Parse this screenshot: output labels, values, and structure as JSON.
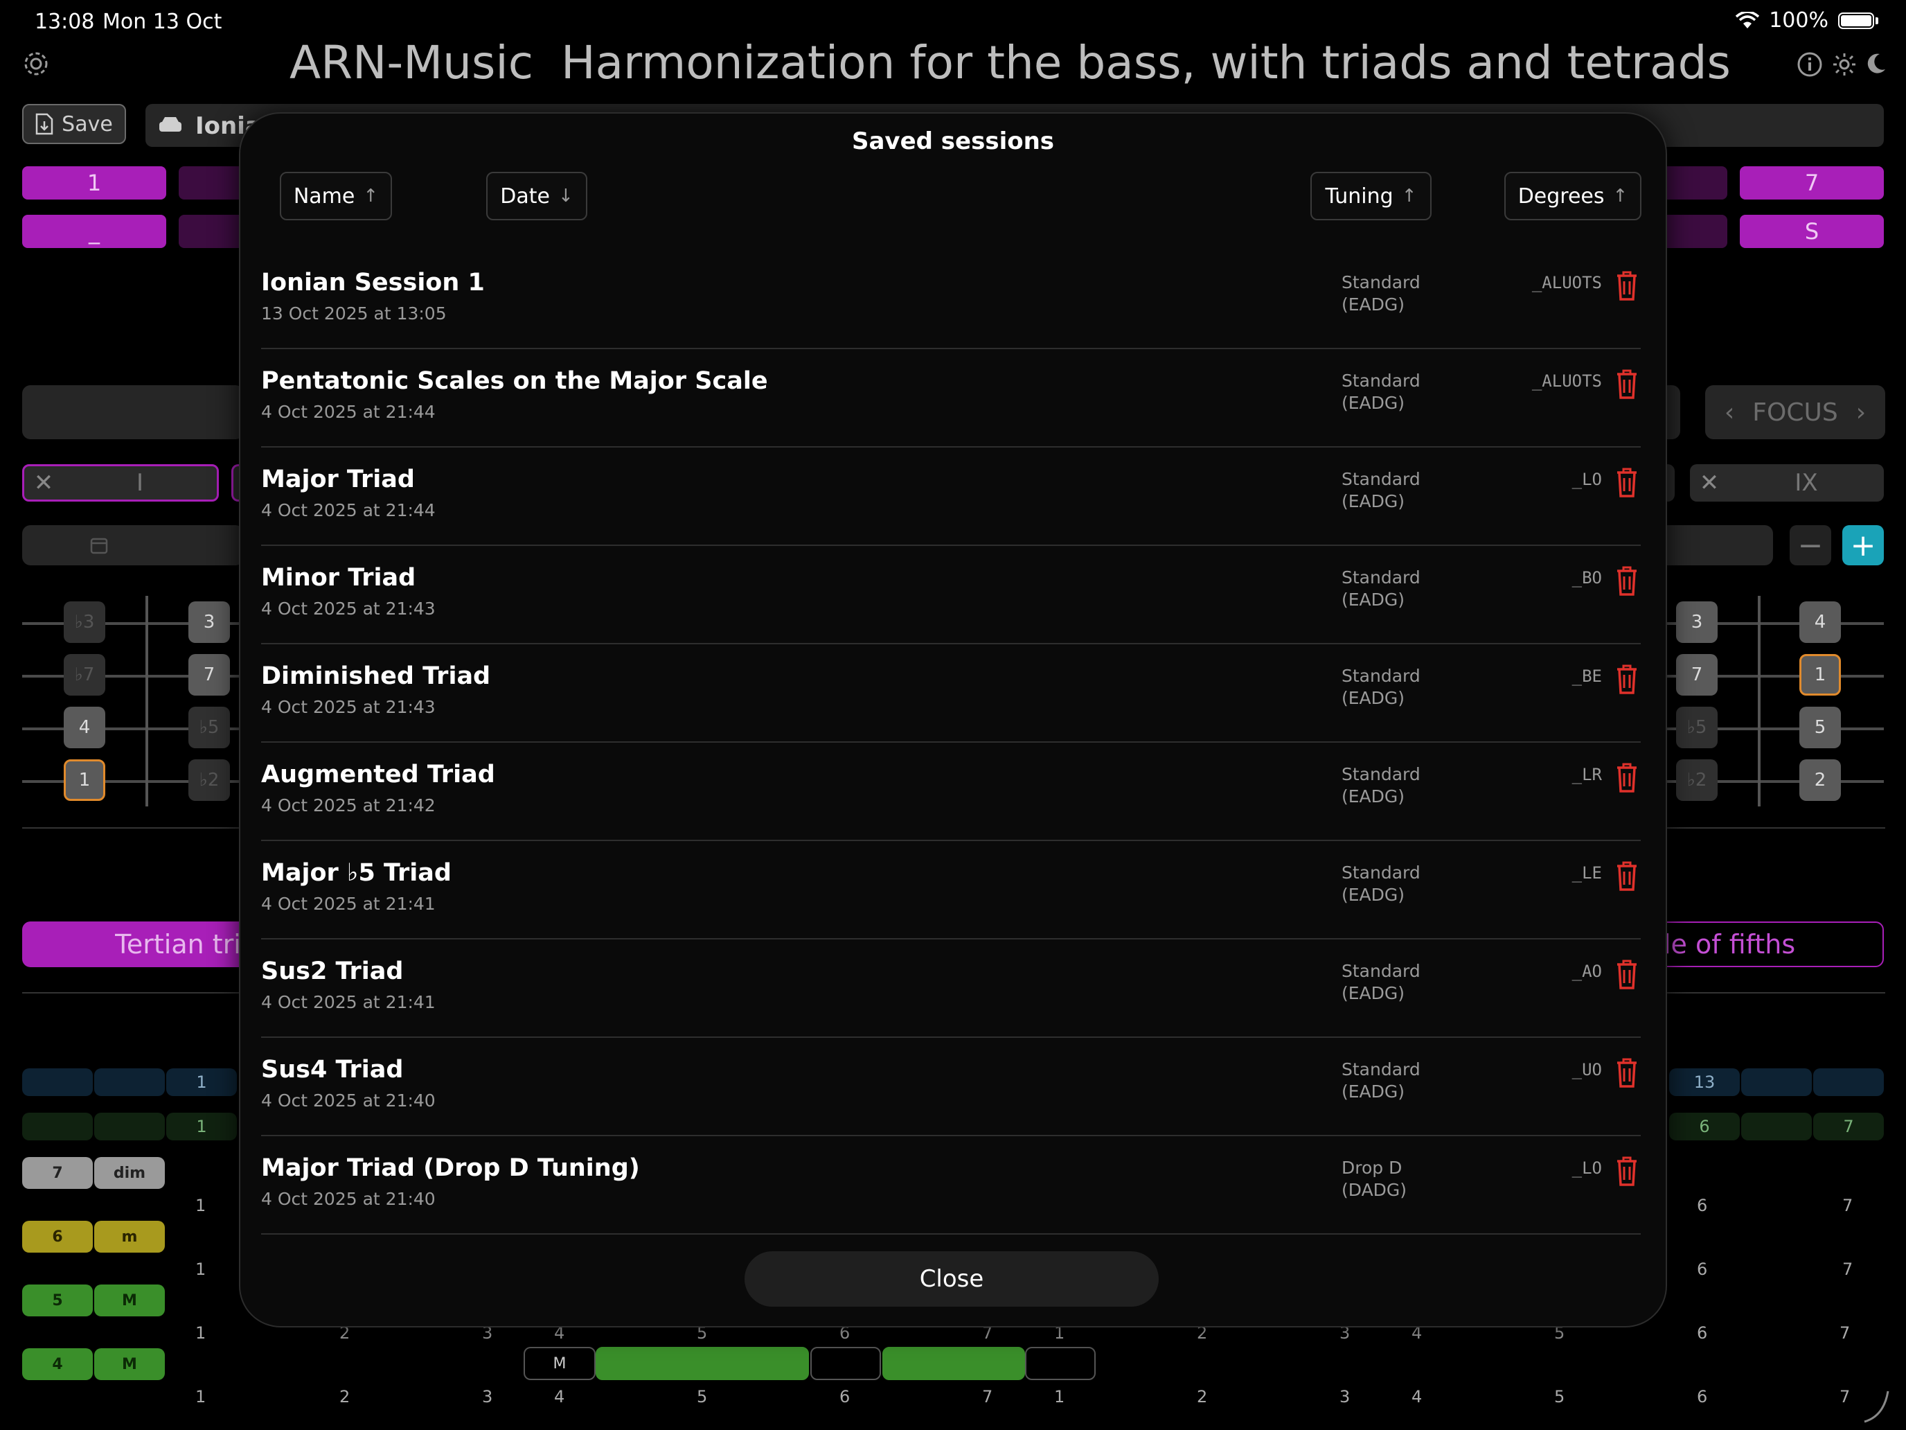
{
  "status": {
    "time": "13:08",
    "date": "Mon 13 Oct",
    "battery": "100%"
  },
  "header": {
    "app_name": "ARN-Music",
    "subtitle": "Harmonization for the bass, with triads and tetrads"
  },
  "toolbar": {
    "save_label": "Save",
    "session_name": "Ionian"
  },
  "degree_rows": {
    "row1": {
      "first": "1",
      "last": "7"
    },
    "row2": {
      "first": "_",
      "last": "S"
    }
  },
  "focus": {
    "label": "FOCUS"
  },
  "chord_slots": {
    "first": "I",
    "last": "IX"
  },
  "fretboard": {
    "left_col1": [
      "♭3",
      "♭7",
      "4",
      "1"
    ],
    "left_col2": [
      "3",
      "7",
      "♭5",
      "♭2"
    ],
    "right_col1": [
      "3",
      "7",
      "♭5",
      "♭2"
    ],
    "right_col2": [
      "4",
      "1",
      "5",
      "2"
    ]
  },
  "modes": {
    "left": "Tertian tri",
    "right": "le of fifths"
  },
  "side_pills": [
    {
      "a": "7",
      "b": "dim"
    },
    {
      "a": "6",
      "b": "m"
    },
    {
      "a": "5",
      "b": "M"
    },
    {
      "a": "4",
      "b": "M"
    }
  ],
  "grid": {
    "top_row_left": "1",
    "top_row_right": "13",
    "second_row_left": "1",
    "second_row_right_a": "6",
    "second_row_right_b": "7",
    "row_numbers": [
      "1",
      "2",
      "3",
      "4",
      "5",
      "6",
      "7",
      "1",
      "2",
      "3",
      "4",
      "5",
      "6",
      "7"
    ]
  },
  "bottom_segment": {
    "label": "M"
  },
  "modal": {
    "title": "Saved sessions",
    "sort": {
      "name": {
        "label": "Name",
        "arrow": "↑"
      },
      "date": {
        "label": "Date",
        "arrow": "↓"
      },
      "tuning": {
        "label": "Tuning",
        "arrow": "↑"
      },
      "degrees": {
        "label": "Degrees",
        "arrow": "↑"
      }
    },
    "sessions": [
      {
        "name": "Ionian Session 1",
        "date": "13 Oct 2025 at 13:05",
        "tuning1": "Standard",
        "tuning2": "(EADG)",
        "degrees": "_ALUOTS"
      },
      {
        "name": "Pentatonic Scales on the Major Scale",
        "date": "4 Oct 2025 at 21:44",
        "tuning1": "Standard",
        "tuning2": "(EADG)",
        "degrees": "_ALUOTS"
      },
      {
        "name": "Major Triad",
        "date": "4 Oct 2025 at 21:44",
        "tuning1": "Standard",
        "tuning2": "(EADG)",
        "degrees": "_LO"
      },
      {
        "name": "Minor Triad",
        "date": "4 Oct 2025 at 21:43",
        "tuning1": "Standard",
        "tuning2": "(EADG)",
        "degrees": "_BO"
      },
      {
        "name": "Diminished Triad",
        "date": "4 Oct 2025 at 21:43",
        "tuning1": "Standard",
        "tuning2": "(EADG)",
        "degrees": "_BE"
      },
      {
        "name": "Augmented Triad",
        "date": "4 Oct 2025 at 21:42",
        "tuning1": "Standard",
        "tuning2": "(EADG)",
        "degrees": "_LR"
      },
      {
        "name": "Major ♭5 Triad",
        "date": "4 Oct 2025 at 21:41",
        "tuning1": "Standard",
        "tuning2": "(EADG)",
        "degrees": "_LE"
      },
      {
        "name": "Sus2 Triad",
        "date": "4 Oct 2025 at 21:41",
        "tuning1": "Standard",
        "tuning2": "(EADG)",
        "degrees": "_AO"
      },
      {
        "name": "Sus4 Triad",
        "date": "4 Oct 2025 at 21:40",
        "tuning1": "Standard",
        "tuning2": "(EADG)",
        "degrees": "_UO"
      },
      {
        "name": "Major Triad (Drop D Tuning)",
        "date": "4 Oct 2025 at 21:40",
        "tuning1": "Drop D",
        "tuning2": "(DADG)",
        "degrees": "_LO"
      }
    ],
    "close_label": "Close"
  },
  "colors": {
    "accent_purple": "#a81fb8",
    "delete_red": "#e0312b",
    "teal": "#1aa3b8",
    "green": "#3a8f2a"
  }
}
